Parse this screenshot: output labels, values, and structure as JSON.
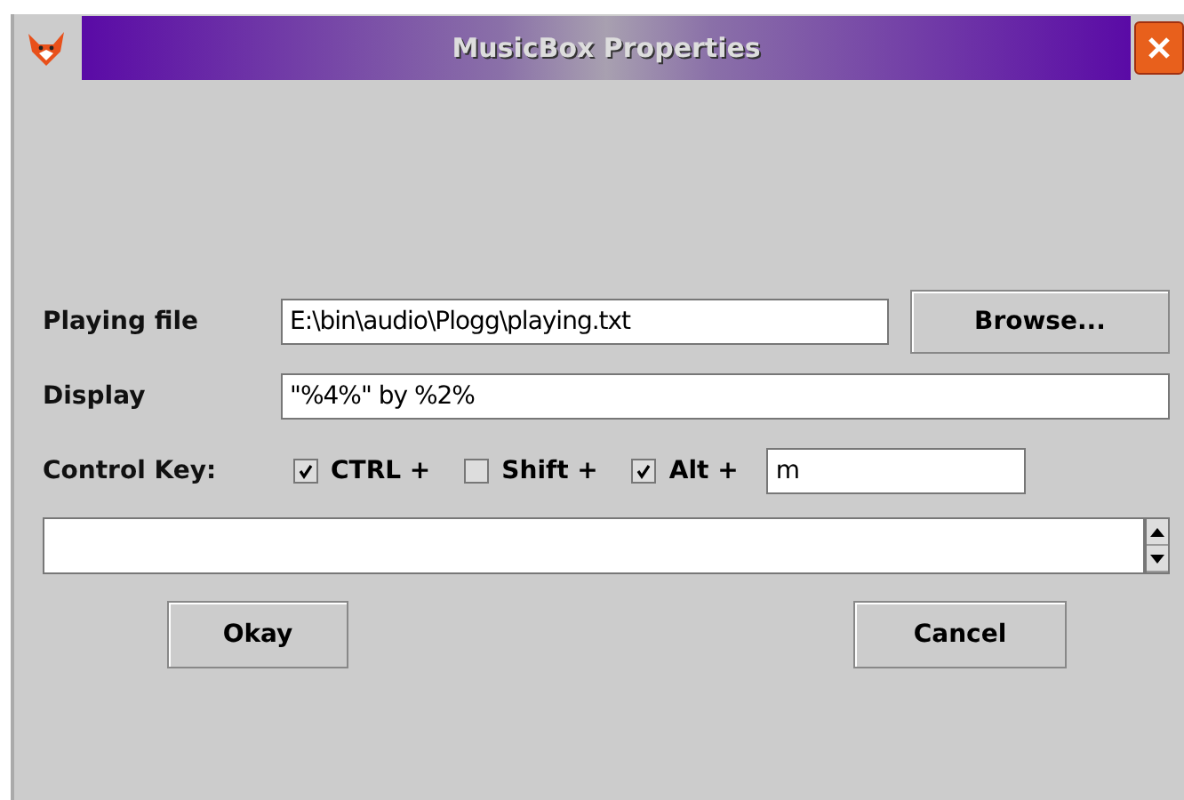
{
  "window": {
    "title": "MusicBox Properties"
  },
  "fields": [
    {
      "label": "Playing file",
      "value": "E:\\bin\\audio\\Plogg\\playing.txt",
      "button": "Browse..."
    },
    {
      "label": "Display",
      "value": "\"%4%\" by %2%"
    }
  ],
  "control_key": {
    "label": "Control Key:",
    "modifiers": [
      {
        "label": "CTRL +",
        "checked": true
      },
      {
        "label": "Shift +",
        "checked": false
      },
      {
        "label": "Alt +",
        "checked": true
      }
    ],
    "key": "m"
  },
  "buttons": [
    "Okay",
    "Cancel"
  ]
}
